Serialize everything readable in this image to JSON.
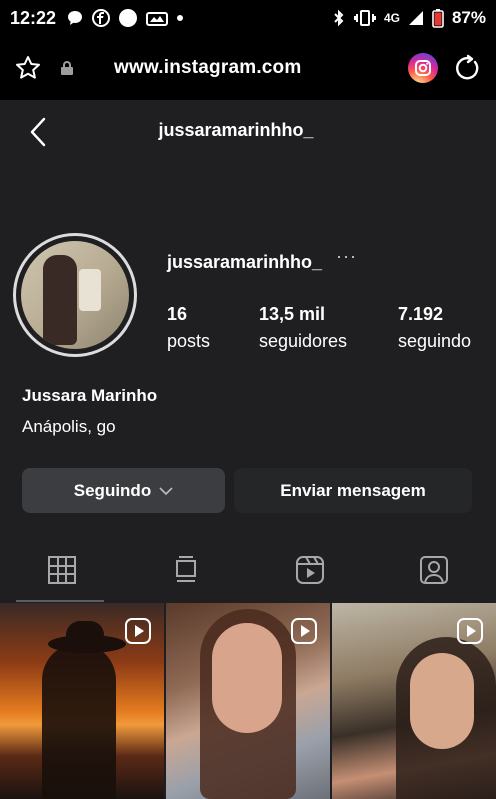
{
  "status_bar": {
    "time": "12:22",
    "network": "4G",
    "battery": "87%"
  },
  "browser": {
    "url": "www.instagram.com"
  },
  "profile": {
    "header_title": "jussaramarinhho_",
    "username": "jussaramarinhho_",
    "more": "···",
    "stats": [
      {
        "value": "16",
        "label": "posts"
      },
      {
        "value": "13,5 mil",
        "label": "seguidores"
      },
      {
        "value": "7.192",
        "label": "seguindo"
      }
    ],
    "full_name": "Jussara Marinho",
    "bio": "Anápolis, go"
  },
  "actions": {
    "following_label": "Seguindo",
    "message_label": "Enviar mensagem"
  },
  "tabs": [
    {
      "icon": "grid-icon",
      "active": true
    },
    {
      "icon": "feed-icon",
      "active": false
    },
    {
      "icon": "reels-icon",
      "active": false
    },
    {
      "icon": "tagged-icon",
      "active": false
    }
  ]
}
